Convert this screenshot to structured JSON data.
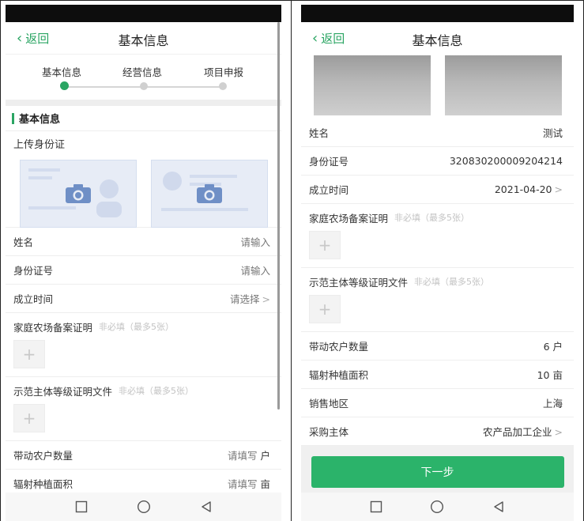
{
  "left": {
    "nav": {
      "back_label": "返回",
      "title": "基本信息"
    },
    "stepper": {
      "steps": [
        {
          "label": "基本信息",
          "active": true
        },
        {
          "label": "经营信息",
          "active": false
        },
        {
          "label": "项目申报",
          "active": false
        }
      ]
    },
    "section_title": "基本信息",
    "upload_id_label": "上传身份证",
    "fields": [
      {
        "label": "姓名",
        "value": "请输入",
        "arrow": ""
      },
      {
        "label": "身份证号",
        "value": "请输入",
        "arrow": ""
      },
      {
        "label": "成立时间",
        "value": "请选择",
        "arrow": ">"
      }
    ],
    "uploads": [
      {
        "label": "家庭农场备案证明",
        "hint": "非必填（最多5张）"
      },
      {
        "label": "示范主体等级证明文件",
        "hint": "非必填（最多5张）"
      }
    ],
    "fields_bottom": [
      {
        "label": "带动农户数量",
        "placeholder": "请填写",
        "unit": "户"
      },
      {
        "label": "辐射种植面积",
        "placeholder": "请填写",
        "unit": "亩"
      }
    ]
  },
  "right": {
    "nav": {
      "back_label": "返回",
      "title": "基本信息"
    },
    "fields": [
      {
        "label": "姓名",
        "value": "测试",
        "arrow": ""
      },
      {
        "label": "身份证号",
        "value": "320830200009204214",
        "arrow": ""
      },
      {
        "label": "成立时间",
        "value": "2021-04-20",
        "arrow": ">"
      }
    ],
    "uploads": [
      {
        "label": "家庭农场备案证明",
        "hint": "非必填（最多5张）"
      },
      {
        "label": "示范主体等级证明文件",
        "hint": "非必填（最多5张）"
      }
    ],
    "fields_bottom": [
      {
        "label": "带动农户数量",
        "value": "6 户",
        "arrow": ""
      },
      {
        "label": "辐射种植面积",
        "value": "10 亩",
        "arrow": ""
      },
      {
        "label": "销售地区",
        "value": "上海",
        "arrow": ""
      },
      {
        "label": "采购主体",
        "value": "农产品加工企业",
        "arrow": ">"
      }
    ],
    "next_button": "下一步"
  },
  "icons": {
    "back": "chevron-left-icon",
    "camera": "camera-icon",
    "plus": "plus-icon",
    "nav_square": "recent-apps-icon",
    "nav_circle": "home-icon",
    "nav_triangle": "back-triangle-icon"
  },
  "colors": {
    "accent": "#2aa563",
    "button": "#2bb36a",
    "status_bar": "#0d0d0d",
    "placeholder": "#777777",
    "hint": "#c3c3c3"
  }
}
